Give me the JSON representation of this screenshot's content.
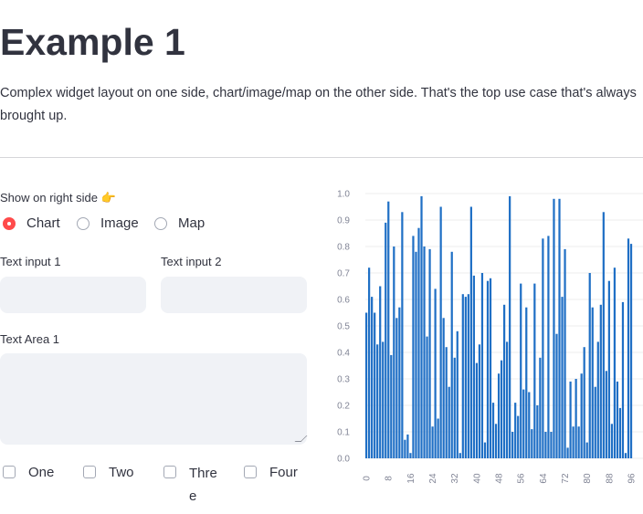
{
  "page": {
    "title": "Example 1",
    "description": "Complex widget layout on one side, chart/image/map on the other side. That's the top use case that's always brought up."
  },
  "controls": {
    "radio_label": "Show on right side 👉",
    "radio_options": [
      "Chart",
      "Image",
      "Map"
    ],
    "radio_selected": "Chart",
    "text_input_1": {
      "label": "Text input 1",
      "value": ""
    },
    "text_input_2": {
      "label": "Text input 2",
      "value": ""
    },
    "text_area_1": {
      "label": "Text Area 1",
      "value": ""
    },
    "checkboxes": [
      {
        "label": "One",
        "checked": false
      },
      {
        "label": "Two",
        "checked": false
      },
      {
        "label": "Three",
        "checked": false
      },
      {
        "label": "Four",
        "checked": false
      }
    ]
  },
  "colors": {
    "accent": "#ff4b4b",
    "bar": "#1f6fc5"
  },
  "chart_data": {
    "type": "bar",
    "x": [
      0,
      1,
      2,
      3,
      4,
      5,
      6,
      7,
      8,
      9,
      10,
      11,
      12,
      13,
      14,
      15,
      16,
      17,
      18,
      19,
      20,
      21,
      22,
      23,
      24,
      25,
      26,
      27,
      28,
      29,
      30,
      31,
      32,
      33,
      34,
      35,
      36,
      37,
      38,
      39,
      40,
      41,
      42,
      43,
      44,
      45,
      46,
      47,
      48,
      49,
      50,
      51,
      52,
      53,
      54,
      55,
      56,
      57,
      58,
      59,
      60,
      61,
      62,
      63,
      64,
      65,
      66,
      67,
      68,
      69,
      70,
      71,
      72,
      73,
      74,
      75,
      76,
      77,
      78,
      79,
      80,
      81,
      82,
      83,
      84,
      85,
      86,
      87,
      88,
      89,
      90,
      91,
      92,
      93,
      94,
      95,
      96,
      97,
      98,
      99
    ],
    "values": [
      0.55,
      0.72,
      0.61,
      0.55,
      0.43,
      0.65,
      0.44,
      0.89,
      0.97,
      0.39,
      0.8,
      0.53,
      0.57,
      0.93,
      0.07,
      0.09,
      0.02,
      0.84,
      0.78,
      0.87,
      0.99,
      0.8,
      0.46,
      0.79,
      0.12,
      0.64,
      0.15,
      0.95,
      0.53,
      0.42,
      0.27,
      0.78,
      0.38,
      0.48,
      0.02,
      0.62,
      0.61,
      0.62,
      0.95,
      0.69,
      0.36,
      0.43,
      0.7,
      0.06,
      0.67,
      0.68,
      0.21,
      0.13,
      0.32,
      0.37,
      0.58,
      0.44,
      0.99,
      0.1,
      0.21,
      0.16,
      0.66,
      0.26,
      0.57,
      0.25,
      0.11,
      0.66,
      0.2,
      0.38,
      0.83,
      0.1,
      0.84,
      0.1,
      0.98,
      0.47,
      0.98,
      0.61,
      0.79,
      0.04,
      0.29,
      0.12,
      0.3,
      0.12,
      0.32,
      0.42,
      0.06,
      0.7,
      0.57,
      0.27,
      0.44,
      0.58,
      0.93,
      0.33,
      0.67,
      0.13,
      0.72,
      0.29,
      0.19,
      0.59,
      0.02,
      0.83,
      0.81,
      0.0,
      0.0,
      0.0
    ],
    "ylim": [
      0,
      1.0
    ],
    "yticks": [
      "0.0",
      "0.1",
      "0.2",
      "0.3",
      "0.4",
      "0.5",
      "0.6",
      "0.7",
      "0.8",
      "0.9",
      "1.0"
    ],
    "xticks": [
      "0",
      "8",
      "16",
      "24",
      "32",
      "40",
      "48",
      "56",
      "64",
      "72",
      "80",
      "88",
      "96"
    ],
    "grid": true
  }
}
